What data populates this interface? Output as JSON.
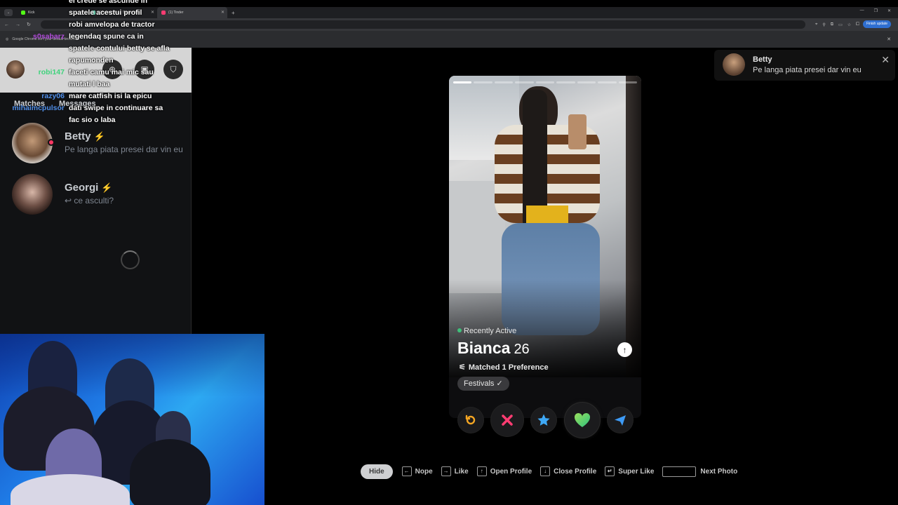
{
  "browser": {
    "tabs": [
      {
        "title": "Kick",
        "color": "#53fc18"
      },
      {
        "title": "(15) Alert Box / Streamlabs",
        "color": "#80f5d2"
      },
      {
        "title": "(1) Tinder",
        "color": "#fe3c72"
      }
    ],
    "active_tab": 2,
    "finish_update_label": "Finish update",
    "infobar_text": "Google Chrome isn't your default browser"
  },
  "chat": [
    {
      "user": "",
      "user_color": "#ffffff",
      "text": "el crede se ascunde in"
    },
    {
      "user": "",
      "user_color": "#ffffff",
      "text": "spatele acestui profil"
    },
    {
      "user": "",
      "user_color": "#ffffff",
      "text": "robi amvelopa de tractor"
    },
    {
      "user": "s0sabarz",
      "user_color": "#b04bd9",
      "text": "legendaq spune ca in"
    },
    {
      "user": "",
      "user_color": "#ffffff",
      "text": "spatele contului betty se afla"
    },
    {
      "user": "",
      "user_color": "#ffffff",
      "text": "rapumonden"
    },
    {
      "user": "robi147",
      "user_color": "#3fd37c",
      "text": "faceti camu mai mic sau"
    },
    {
      "user": "",
      "user_color": "#ffffff",
      "text": "mutati l baa"
    },
    {
      "user": "razy06",
      "user_color": "#4f8ee8",
      "text": "mare catfish isi la epicu"
    },
    {
      "user": "mihaimcpulsor",
      "user_color": "#4f8ee8",
      "text": "dati swipe in continuare sa"
    },
    {
      "user": "",
      "user_color": "#ffffff",
      "text": "fac sio o laba"
    }
  ],
  "sidebar": {
    "tabs": [
      "Matches",
      "Messages"
    ],
    "conversations": [
      {
        "name": "Betty",
        "message": "Pe langa piata presei dar vin eu",
        "unread": true
      },
      {
        "name": "Georgi",
        "message": "↩ ce asculti?",
        "unread": false
      }
    ]
  },
  "profile": {
    "status": "Recently Active",
    "name": "Bianca",
    "age": "26",
    "matched": "Matched 1 Preference",
    "tags": [
      "Festivals ✓"
    ],
    "photo_count": 9,
    "current_photo": 1
  },
  "actions": [
    {
      "name": "rewind",
      "color": "#f5a623"
    },
    {
      "name": "nope",
      "color": "#fe3c72"
    },
    {
      "name": "super-like",
      "color": "#3ea8f5"
    },
    {
      "name": "like",
      "color": "#6bd46b"
    },
    {
      "name": "boost",
      "color": "#3e9bf5"
    }
  ],
  "shortcuts": {
    "hide": "Hide",
    "items": [
      {
        "key": "←",
        "label": "Nope"
      },
      {
        "key": "→",
        "label": "Like"
      },
      {
        "key": "↑",
        "label": "Open Profile"
      },
      {
        "key": "↓",
        "label": "Close Profile"
      },
      {
        "key": "↵",
        "label": "Super Like"
      },
      {
        "key": "",
        "label": "Next Photo"
      }
    ]
  },
  "notification": {
    "title": "Betty",
    "message": "Pe langa piata presei dar vin eu"
  }
}
